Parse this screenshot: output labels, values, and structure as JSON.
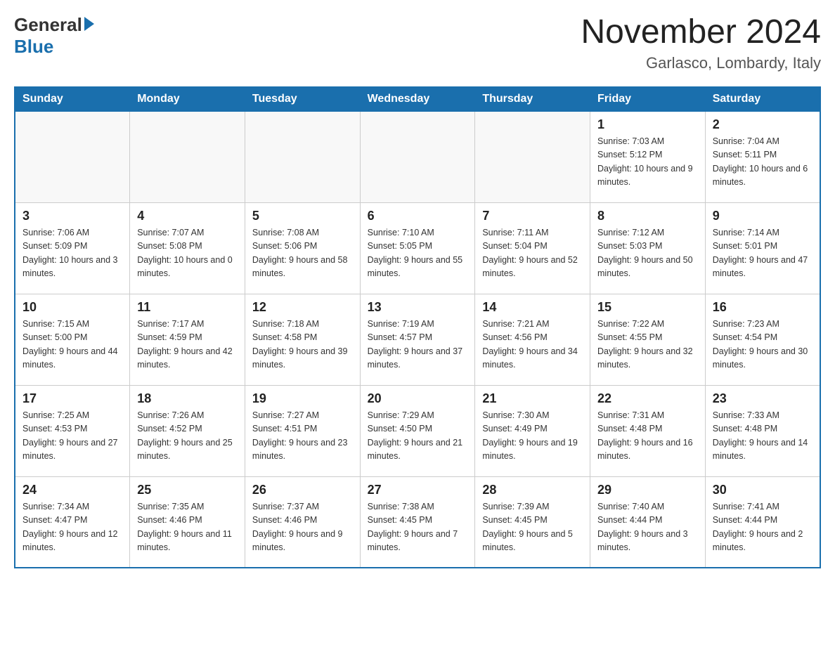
{
  "header": {
    "logo_general": "General",
    "logo_blue": "Blue",
    "title": "November 2024",
    "subtitle": "Garlasco, Lombardy, Italy"
  },
  "weekdays": [
    "Sunday",
    "Monday",
    "Tuesday",
    "Wednesday",
    "Thursday",
    "Friday",
    "Saturday"
  ],
  "rows": [
    [
      {
        "day": "",
        "info": ""
      },
      {
        "day": "",
        "info": ""
      },
      {
        "day": "",
        "info": ""
      },
      {
        "day": "",
        "info": ""
      },
      {
        "day": "",
        "info": ""
      },
      {
        "day": "1",
        "info": "Sunrise: 7:03 AM\nSunset: 5:12 PM\nDaylight: 10 hours and 9 minutes."
      },
      {
        "day": "2",
        "info": "Sunrise: 7:04 AM\nSunset: 5:11 PM\nDaylight: 10 hours and 6 minutes."
      }
    ],
    [
      {
        "day": "3",
        "info": "Sunrise: 7:06 AM\nSunset: 5:09 PM\nDaylight: 10 hours and 3 minutes."
      },
      {
        "day": "4",
        "info": "Sunrise: 7:07 AM\nSunset: 5:08 PM\nDaylight: 10 hours and 0 minutes."
      },
      {
        "day": "5",
        "info": "Sunrise: 7:08 AM\nSunset: 5:06 PM\nDaylight: 9 hours and 58 minutes."
      },
      {
        "day": "6",
        "info": "Sunrise: 7:10 AM\nSunset: 5:05 PM\nDaylight: 9 hours and 55 minutes."
      },
      {
        "day": "7",
        "info": "Sunrise: 7:11 AM\nSunset: 5:04 PM\nDaylight: 9 hours and 52 minutes."
      },
      {
        "day": "8",
        "info": "Sunrise: 7:12 AM\nSunset: 5:03 PM\nDaylight: 9 hours and 50 minutes."
      },
      {
        "day": "9",
        "info": "Sunrise: 7:14 AM\nSunset: 5:01 PM\nDaylight: 9 hours and 47 minutes."
      }
    ],
    [
      {
        "day": "10",
        "info": "Sunrise: 7:15 AM\nSunset: 5:00 PM\nDaylight: 9 hours and 44 minutes."
      },
      {
        "day": "11",
        "info": "Sunrise: 7:17 AM\nSunset: 4:59 PM\nDaylight: 9 hours and 42 minutes."
      },
      {
        "day": "12",
        "info": "Sunrise: 7:18 AM\nSunset: 4:58 PM\nDaylight: 9 hours and 39 minutes."
      },
      {
        "day": "13",
        "info": "Sunrise: 7:19 AM\nSunset: 4:57 PM\nDaylight: 9 hours and 37 minutes."
      },
      {
        "day": "14",
        "info": "Sunrise: 7:21 AM\nSunset: 4:56 PM\nDaylight: 9 hours and 34 minutes."
      },
      {
        "day": "15",
        "info": "Sunrise: 7:22 AM\nSunset: 4:55 PM\nDaylight: 9 hours and 32 minutes."
      },
      {
        "day": "16",
        "info": "Sunrise: 7:23 AM\nSunset: 4:54 PM\nDaylight: 9 hours and 30 minutes."
      }
    ],
    [
      {
        "day": "17",
        "info": "Sunrise: 7:25 AM\nSunset: 4:53 PM\nDaylight: 9 hours and 27 minutes."
      },
      {
        "day": "18",
        "info": "Sunrise: 7:26 AM\nSunset: 4:52 PM\nDaylight: 9 hours and 25 minutes."
      },
      {
        "day": "19",
        "info": "Sunrise: 7:27 AM\nSunset: 4:51 PM\nDaylight: 9 hours and 23 minutes."
      },
      {
        "day": "20",
        "info": "Sunrise: 7:29 AM\nSunset: 4:50 PM\nDaylight: 9 hours and 21 minutes."
      },
      {
        "day": "21",
        "info": "Sunrise: 7:30 AM\nSunset: 4:49 PM\nDaylight: 9 hours and 19 minutes."
      },
      {
        "day": "22",
        "info": "Sunrise: 7:31 AM\nSunset: 4:48 PM\nDaylight: 9 hours and 16 minutes."
      },
      {
        "day": "23",
        "info": "Sunrise: 7:33 AM\nSunset: 4:48 PM\nDaylight: 9 hours and 14 minutes."
      }
    ],
    [
      {
        "day": "24",
        "info": "Sunrise: 7:34 AM\nSunset: 4:47 PM\nDaylight: 9 hours and 12 minutes."
      },
      {
        "day": "25",
        "info": "Sunrise: 7:35 AM\nSunset: 4:46 PM\nDaylight: 9 hours and 11 minutes."
      },
      {
        "day": "26",
        "info": "Sunrise: 7:37 AM\nSunset: 4:46 PM\nDaylight: 9 hours and 9 minutes."
      },
      {
        "day": "27",
        "info": "Sunrise: 7:38 AM\nSunset: 4:45 PM\nDaylight: 9 hours and 7 minutes."
      },
      {
        "day": "28",
        "info": "Sunrise: 7:39 AM\nSunset: 4:45 PM\nDaylight: 9 hours and 5 minutes."
      },
      {
        "day": "29",
        "info": "Sunrise: 7:40 AM\nSunset: 4:44 PM\nDaylight: 9 hours and 3 minutes."
      },
      {
        "day": "30",
        "info": "Sunrise: 7:41 AM\nSunset: 4:44 PM\nDaylight: 9 hours and 2 minutes."
      }
    ]
  ]
}
